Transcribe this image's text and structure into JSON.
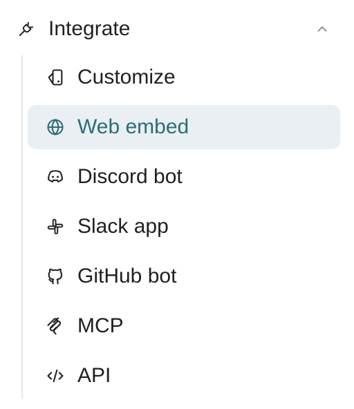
{
  "section": {
    "title": "Integrate",
    "icon": "plug-icon",
    "collapse_icon": "chevron-up-icon"
  },
  "nav": {
    "items": [
      {
        "label": "Customize",
        "icon": "customize-icon",
        "active": false
      },
      {
        "label": "Web embed",
        "icon": "globe-icon",
        "active": true
      },
      {
        "label": "Discord bot",
        "icon": "discord-icon",
        "active": false
      },
      {
        "label": "Slack app",
        "icon": "slack-icon",
        "active": false
      },
      {
        "label": "GitHub bot",
        "icon": "github-icon",
        "active": false
      },
      {
        "label": "MCP",
        "icon": "mcp-icon",
        "active": false
      },
      {
        "label": "API",
        "icon": "code-icon",
        "active": false
      }
    ]
  },
  "colors": {
    "active_bg": "#e9eff2",
    "active_text": "#2b6d78",
    "text": "#1f1f1f",
    "rail": "#e3e5e8"
  }
}
